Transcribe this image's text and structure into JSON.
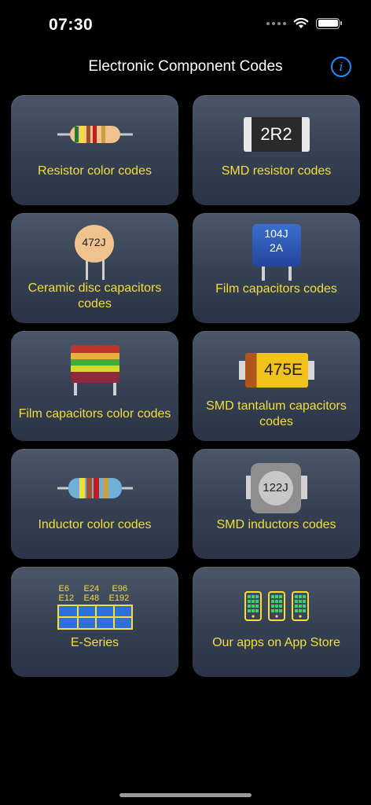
{
  "status": {
    "time": "07:30"
  },
  "nav": {
    "title": "Electronic Component Codes",
    "info_glyph": "i"
  },
  "cards": [
    {
      "label": "Resistor color codes",
      "icon": "resistor-icon"
    },
    {
      "label": "SMD resistor codes",
      "icon": "smd-resistor-icon",
      "code": "2R2"
    },
    {
      "label": "Ceramic disc capacitors codes",
      "icon": "ceramic-capacitor-icon",
      "code": "472J"
    },
    {
      "label": "Film capacitors codes",
      "icon": "film-capacitor-icon",
      "code_line1": "104J",
      "code_line2": "2A"
    },
    {
      "label": "Film capacitors color codes",
      "icon": "film-capacitor-color-icon"
    },
    {
      "label": "SMD tantalum capacitors codes",
      "icon": "tantalum-capacitor-icon",
      "code": "475E"
    },
    {
      "label": "Inductor color codes",
      "icon": "inductor-icon"
    },
    {
      "label": "SMD inductors codes",
      "icon": "smd-inductor-icon",
      "code": "122J"
    },
    {
      "label": "E-Series",
      "icon": "e-series-icon",
      "series": [
        "E6",
        "E12",
        "E24",
        "E48",
        "E96",
        "E192"
      ]
    },
    {
      "label": "Our apps on App Store",
      "icon": "phones-icon"
    }
  ],
  "colors": {
    "accent": "#f3de3a",
    "card_top": "#4b5668",
    "card_bottom": "#2a3446",
    "info_blue": "#1f8cff"
  }
}
